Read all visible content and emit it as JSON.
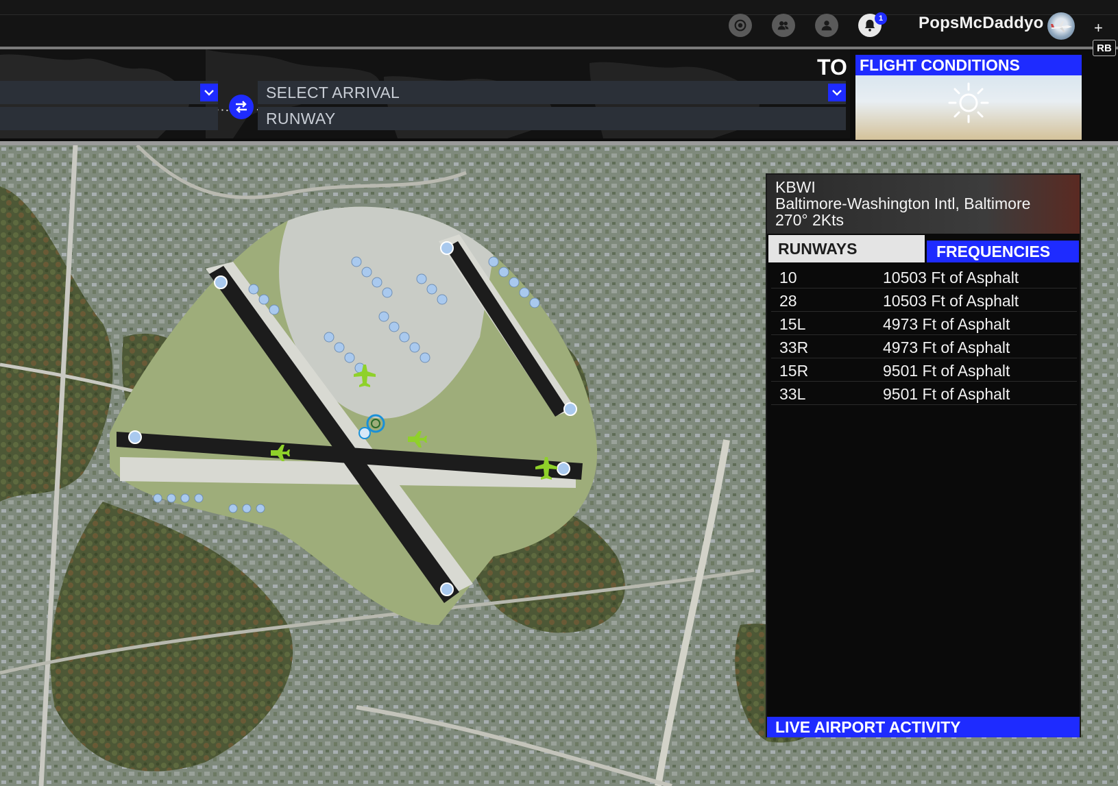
{
  "header": {
    "username": "PopsMcDaddyo",
    "notification_count": "1",
    "plus_label": "+",
    "rb_label": "RB",
    "icons": [
      "achievements-icon",
      "friends-icon",
      "profile-icon",
      "notifications-icon"
    ]
  },
  "route": {
    "departure_value": "",
    "departure_runway": "",
    "to_label": "TO",
    "arrival_placeholder": "SELECT ARRIVAL",
    "arrival_runway_placeholder": "RUNWAY"
  },
  "flight_conditions": {
    "title": "FLIGHT CONDITIONS",
    "weather_icon": "sun-icon"
  },
  "airport": {
    "icao": "KBWI",
    "name": "Baltimore-Washington Intl, Baltimore",
    "wind": "270° 2Kts",
    "tabs": {
      "runways": "RUNWAYS",
      "frequencies": "FREQUENCIES"
    },
    "runways": [
      {
        "id": "10",
        "length": "10503 Ft of Asphalt"
      },
      {
        "id": "28",
        "length": "10503 Ft of Asphalt"
      },
      {
        "id": "15L",
        "length": "4973 Ft of Asphalt"
      },
      {
        "id": "33R",
        "length": "4973 Ft of Asphalt"
      },
      {
        "id": "15R",
        "length": "9501 Ft of Asphalt"
      },
      {
        "id": "33L",
        "length": "9501 Ft of Asphalt"
      }
    ],
    "live_activity_label": "LIVE AIRPORT ACTIVITY"
  },
  "colors": {
    "accent": "#1e2bff",
    "runway": "#1c1c1c",
    "aircraft": "#8fd12a",
    "runway_end_marker": "#a9c9ee"
  }
}
